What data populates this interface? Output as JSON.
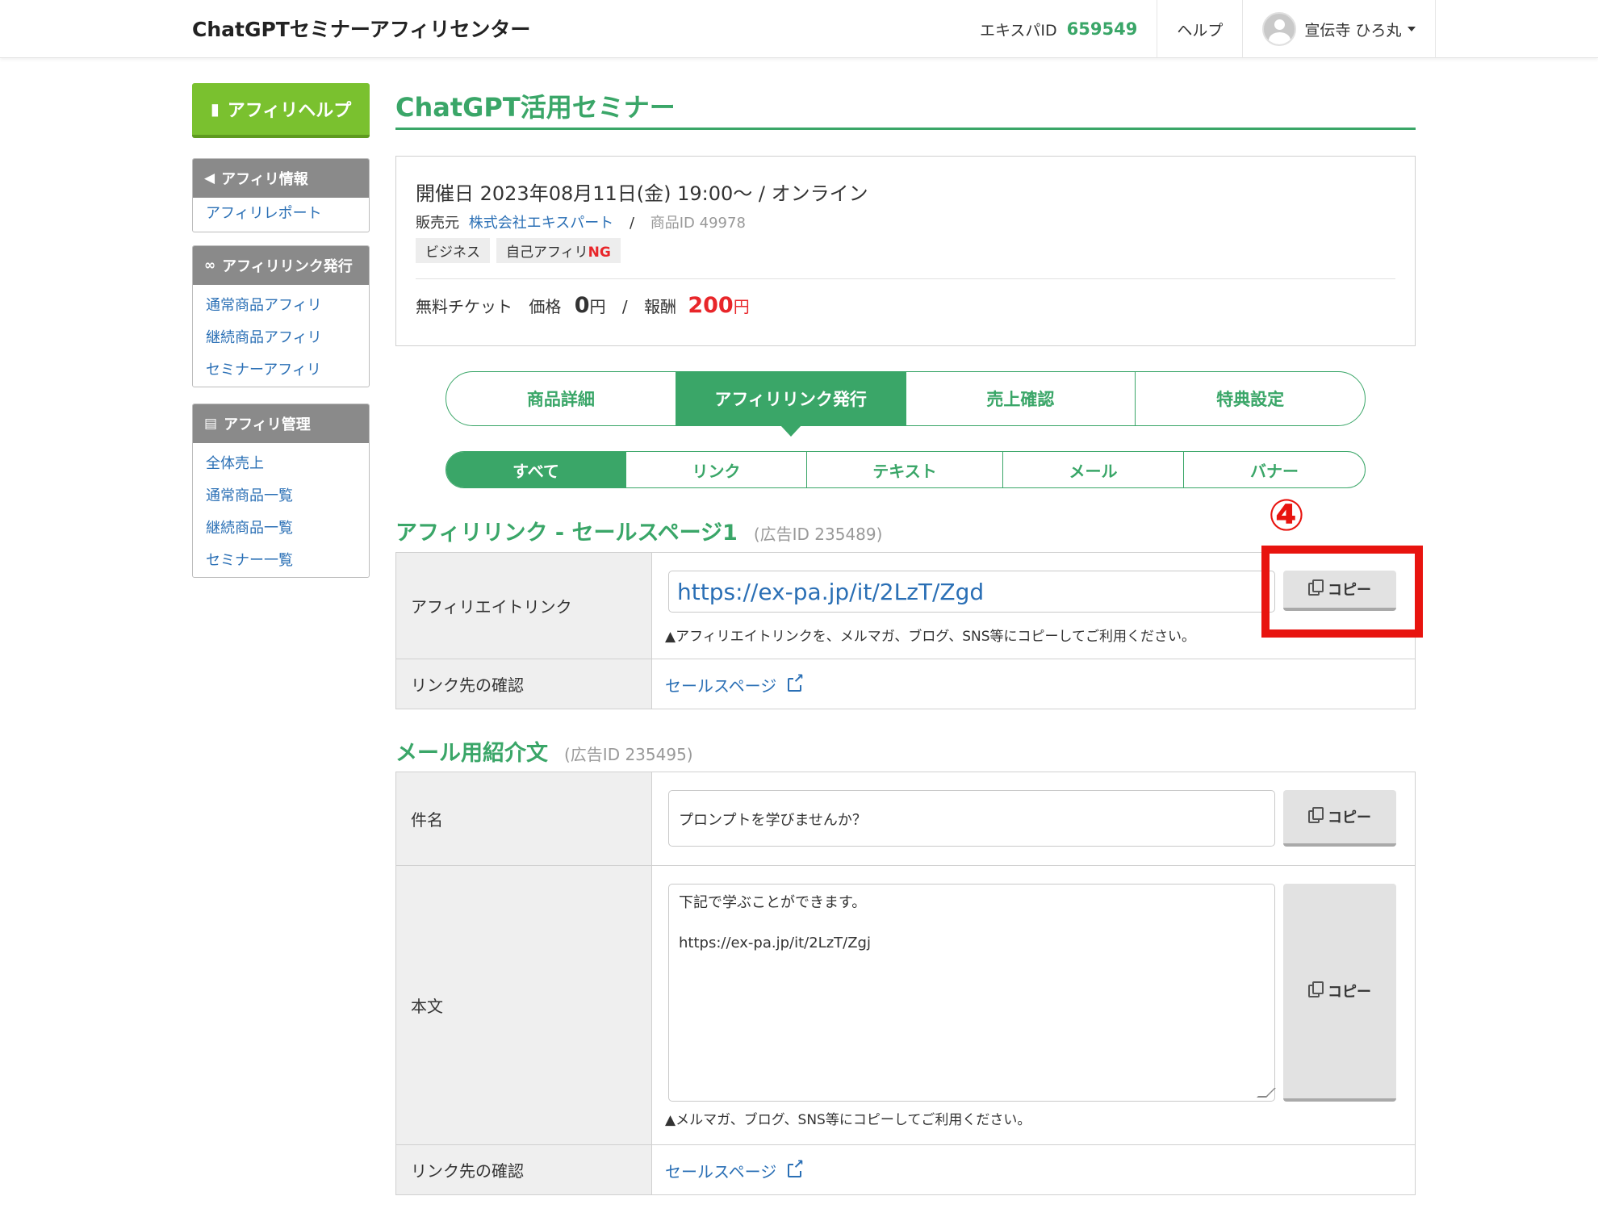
{
  "header": {
    "brand": "ChatGPTセミナーアフィリセンター",
    "id_label": "エキスパID",
    "id_value": "659549",
    "help": "ヘルプ",
    "user_name": "宣伝寺 ひろ丸"
  },
  "sidebar": {
    "help_button": "アフィリヘルプ",
    "groups": [
      {
        "title": "アフィリ情報",
        "icon": "megaphone-icon",
        "items": [
          "アフィリレポート"
        ]
      },
      {
        "title": "アフィリリンク発行",
        "icon": "link-icon",
        "items": [
          "通常商品アフィリ",
          "継続商品アフィリ",
          "セミナーアフィリ"
        ]
      },
      {
        "title": "アフィリ管理",
        "icon": "file-icon",
        "items": [
          "全体売上",
          "通常商品一覧",
          "継続商品一覧",
          "セミナー一覧"
        ]
      }
    ]
  },
  "product": {
    "title": "ChatGPT活用セミナー",
    "date": "開催日 2023年08月11日(金) 19:00〜  /  オンライン",
    "seller_label": "販売元",
    "seller": "株式会社エキスパート",
    "separator": "/",
    "product_id": "商品ID 49978",
    "tag_business": "ビジネス",
    "tag_self_prefix": "自己アフィリ",
    "tag_self_ng": "NG",
    "ticket_label": "無料チケット",
    "price_label": "価格",
    "price_value": "0",
    "yen": "円",
    "reward_label": "報酬",
    "reward_value": "200"
  },
  "tabs": [
    "商品詳細",
    "アフィリリンク発行",
    "売上確認",
    "特典設定"
  ],
  "active_tab": 1,
  "subtabs": [
    "すべて",
    "リンク",
    "テキスト",
    "メール",
    "バナー"
  ],
  "section1": {
    "title": "アフィリリンク - セールスページ1",
    "ad_id": "(広告ID 235489)",
    "link_label": "アフィリエイトリンク",
    "link_value": "https://ex-pa.jp/it/2LzT/Zgd",
    "copy": "コピー",
    "note": "▲アフィリエイトリンクを、メルマガ、ブログ、SNS等にコピーしてご利用ください。",
    "confirm_label": "リンク先の確認",
    "confirm_link": "セールスページ"
  },
  "section2": {
    "title": "メール用紹介文",
    "ad_id": "(広告ID 235495)",
    "subject_label": "件名",
    "subject_value": "プロンプトを学びませんか？",
    "body_label": "本文",
    "body_value": "下記で学ぶことができます。\n\nhttps://ex-pa.jp/it/2LzT/Zgj",
    "copy": "コピー",
    "note": "▲メルマガ、ブログ、SNS等にコピーしてご利用ください。",
    "confirm_label": "リンク先の確認",
    "confirm_link": "セールスページ"
  },
  "annotation": {
    "step": "④",
    "color": "#e8140f"
  },
  "colors": {
    "accent": "#3aa668",
    "help_green": "#7ac12f",
    "link": "#2a6fb5",
    "red": "#e8262a"
  }
}
